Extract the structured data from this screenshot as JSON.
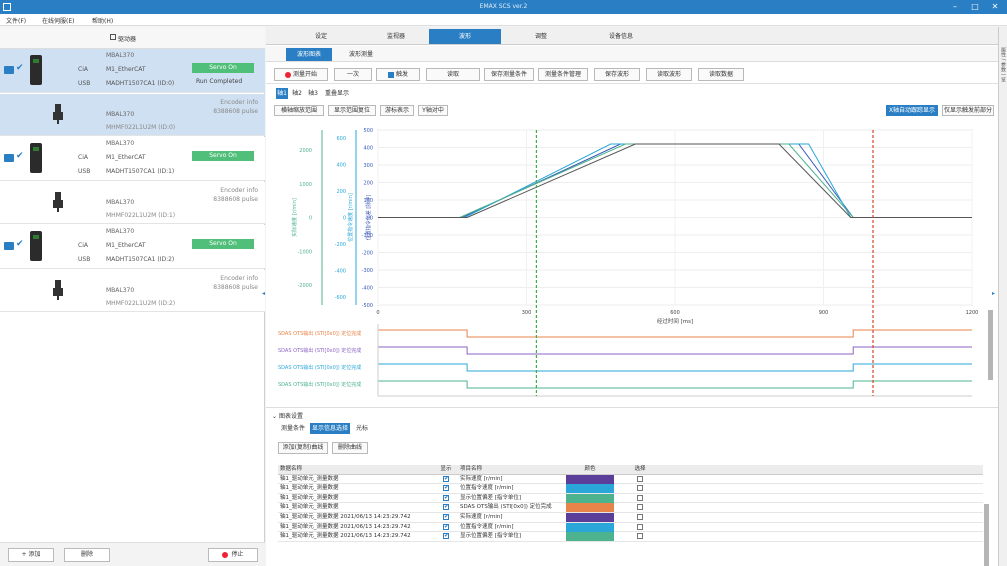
{
  "window": {
    "title": "EMAX SCS ver.2"
  },
  "menu": [
    "文件(F)",
    "在线伺服(E)",
    "帮助(H)"
  ],
  "left": {
    "header": "驱动器",
    "drives": [
      {
        "model": "MBAL370",
        "key1": "CiA",
        "val1": "M1_EtherCAT",
        "key2": "USB",
        "val2": "MADHT1507CA1 (ID:0)",
        "status": "Servo On",
        "stat2": "Run Completed"
      },
      {
        "model": "MBAL370",
        "key1": "CiA",
        "val1": "M1_EtherCAT",
        "key2": "USB",
        "val2": "MADHT1507CA1 (ID:1)",
        "status": "Servo On",
        "stat2": ""
      },
      {
        "model": "MBAL370",
        "key1": "CiA",
        "val1": "M1_EtherCAT",
        "key2": "USB",
        "val2": "MADHT1507CA1 (ID:2)",
        "status": "Servo On",
        "stat2": ""
      }
    ],
    "motors": [
      {
        "model": "MBAL370",
        "part": "MHMF022L1U2M (ID:0)",
        "encoder_label": "Encoder info",
        "encoder_val": "8388608 pulse"
      },
      {
        "model": "MBAL370",
        "part": "MHMF022L1U2M (ID:1)",
        "encoder_label": "Encoder info",
        "encoder_val": "8388608 pulse"
      },
      {
        "model": "MBAL370",
        "part": "MHMF022L1U2M (ID:2)",
        "encoder_label": "Encoder info",
        "encoder_val": "8388608 pulse"
      }
    ],
    "footer": {
      "add": "+ 添加",
      "delete": "删除",
      "stop": "停止"
    }
  },
  "tabs": [
    "设定",
    "监视器",
    "波形",
    "调整",
    "设备信息"
  ],
  "subtabs": [
    "波形图表",
    "波形测量"
  ],
  "toolbar": [
    "测量开始",
    "一次",
    "触发",
    "读取",
    "保存测量条件",
    "测量条件管理",
    "保存波形",
    "读取波形",
    "读取数据"
  ],
  "chart_tabs": [
    "轴1",
    "轴2",
    "轴3",
    "重叠显示"
  ],
  "chart_buttons": [
    "横轴缩放范围",
    "显示范围复位",
    "游标表示",
    "Y轴对中",
    "X轴自动跟踪显示",
    "仅显示触发前部分"
  ],
  "chart_data": {
    "type": "line",
    "xlabel": "经过时间 [ms]",
    "x_ticks": [
      "0",
      "300",
      "600",
      "900",
      "1200"
    ],
    "xlim": [
      0,
      1200
    ],
    "y_axes": [
      {
        "label": "位置指令偏差 [脉冲]",
        "ticks": [
          "500",
          "400",
          "300",
          "200",
          "100",
          "0",
          "-100",
          "-200",
          "-300",
          "-400",
          "-500"
        ]
      },
      {
        "label": "位置指令速度 [r/min]",
        "ticks": [
          "600",
          "400",
          "200",
          "0",
          "-200",
          "-400",
          "-600"
        ]
      },
      {
        "label": "实际速度 [r/min]",
        "ticks": [
          "2000",
          "1000",
          "0",
          "-1000",
          "-2000"
        ]
      }
    ],
    "series": [
      {
        "color": "#3b58b8",
        "x": [
          0,
          170,
          490,
          850,
          960,
          1200
        ],
        "y": [
          0,
          0,
          420,
          420,
          0,
          0
        ]
      },
      {
        "color": "#2aa7d8",
        "x": [
          0,
          175,
          470,
          870,
          955,
          1200
        ],
        "y": [
          0,
          0,
          420,
          420,
          0,
          0
        ]
      },
      {
        "color": "#4db38e",
        "x": [
          0,
          165,
          500,
          830,
          960,
          1200
        ],
        "y": [
          0,
          0,
          420,
          420,
          0,
          0
        ]
      },
      {
        "color": "#555555",
        "x": [
          0,
          180,
          520,
          810,
          955,
          1200
        ],
        "y": [
          0,
          0,
          420,
          420,
          0,
          0
        ]
      }
    ],
    "cursor_green_x": 320,
    "cursor_red_x": 1000,
    "digital_rows": [
      {
        "label": "SDAS OTS输出 (STI[0x0]) 定位完成",
        "color": "#e8834a",
        "high_start": 0,
        "high_end": 180,
        "high2_start": 960
      },
      {
        "label": "SDAS OTS输出 (STI[0x0]) 定位完成",
        "color": "#8b62c6",
        "high_start": 0,
        "high_end": 180,
        "high2_start": 960
      },
      {
        "label": "SDAS OTS输出 (STI[0x0]) 定位完成",
        "color": "#2aa7d8",
        "high_start": 0,
        "high_end": 180,
        "high2_start": 960
      },
      {
        "label": "SDAS OTS输出 (STI[0x0]) 定位完成",
        "color": "#4db38e",
        "high_start": 0,
        "high_end": 180,
        "high2_start": 960
      }
    ]
  },
  "params": {
    "header": "图表设置",
    "tabs": [
      "测量条件",
      "显示信息选择",
      "光标"
    ],
    "buttons": [
      "添加(复制)曲线",
      "删除曲线"
    ],
    "columns": [
      "数据名称",
      "显示",
      "项目名称",
      "颜色",
      "选择"
    ],
    "rows": [
      {
        "name": "轴1_驱动单元_测量数据",
        "show": true,
        "item": "实际速度 [r/min]",
        "color": "#5a3e9a",
        "sel": false
      },
      {
        "name": "轴1_驱动单元_测量数据",
        "show": true,
        "item": "位置指令速度 [r/min]",
        "color": "#2aa7d8",
        "sel": false
      },
      {
        "name": "轴1_驱动单元_测量数据",
        "show": true,
        "item": "显示位置偏差 [指令单位]",
        "color": "#4db38e",
        "sel": false
      },
      {
        "name": "轴1_驱动单元_测量数据",
        "show": true,
        "item": "SDAS OTS输出 (STI[0x0]) 定位完成",
        "color": "#e8834a",
        "sel": false
      },
      {
        "name": "轴1_驱动单元_测量数据 2021/06/13 14:23:29.742",
        "show": true,
        "item": "实际速度 [r/min]",
        "color": "#5a3e9a",
        "sel": false
      },
      {
        "name": "轴1_驱动单元_测量数据 2021/06/13 14:23:29.742",
        "show": true,
        "item": "位置指令速度 [r/min]",
        "color": "#2aa7d8",
        "sel": false
      },
      {
        "name": "轴1_驱动单元_测量数据 2021/06/13 14:23:29.742",
        "show": true,
        "item": "显示位置偏差 [指令单位]",
        "color": "#4db38e",
        "sel": false
      }
    ]
  },
  "right_sidebar": "属性 / 参数一览"
}
